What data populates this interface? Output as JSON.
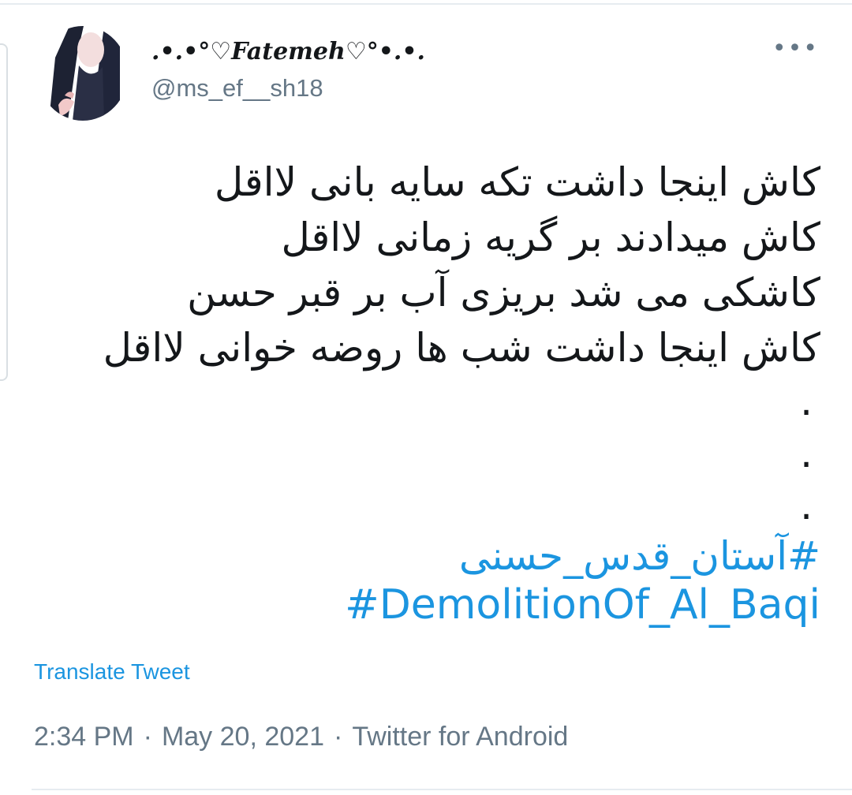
{
  "tweet": {
    "author": {
      "display_name": ".•.•°♡Fatemeh♡°•.•.",
      "handle": "@ms_ef__sh18"
    },
    "more_icon": "more-horizontal-icon",
    "lines": [
      "کاش اینجا داشت تکه سایه بانی لااقل",
      "کاش میدادند بر گریه زمانی لااقل",
      "کاشکی می شد بریزی آب بر قبر حسن",
      "کاش اینجا داشت شب ها روضه خوانی لااقل"
    ],
    "dots": [
      ".",
      ".",
      "."
    ],
    "hashtags": {
      "fa": "#آستان_قدس_حسنی",
      "en": "#DemolitionOf_Al_Baqi"
    },
    "translate_label": "Translate Tweet",
    "meta": {
      "time": "2:34 PM",
      "separator": "·",
      "date": "May 20, 2021",
      "source": "Twitter for Android"
    }
  },
  "colors": {
    "link": "#1b95e0",
    "muted": "#657786",
    "text": "#14171a"
  }
}
